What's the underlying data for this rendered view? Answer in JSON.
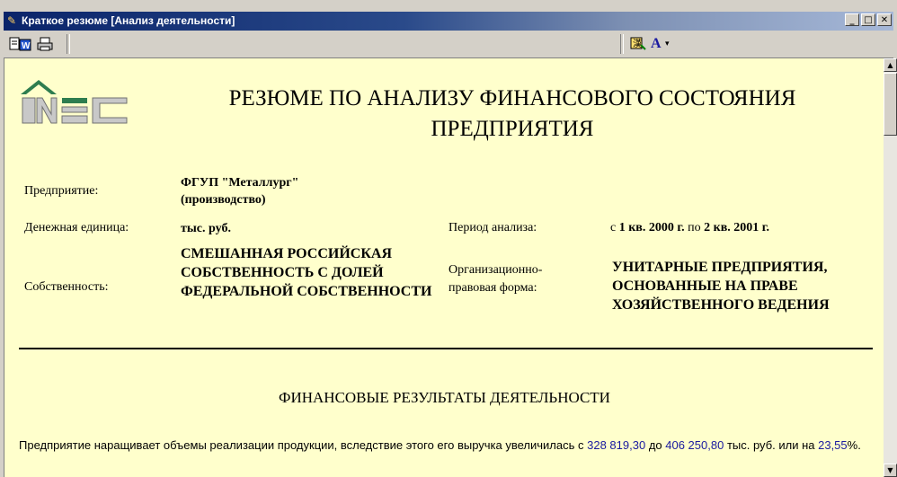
{
  "window": {
    "title": "Краткое резюме [Анализ деятельности]",
    "buttons": {
      "minimize": "_",
      "maximize": "□",
      "close": "✕"
    }
  },
  "toolbar": {
    "font_button": "A",
    "dropdown_arrow": "▾"
  },
  "report": {
    "logo_text": "INEC",
    "title": "РЕЗЮМЕ ПО АНАЛИЗУ ФИНАНСОВОГО СОСТОЯНИЯ ПРЕДПРИЯТИЯ",
    "enterprise_label": "Предприятие:",
    "enterprise_value": "ФГУП \"Металлург\" (производство)",
    "currency_label": "Денежная единица:",
    "currency_value": "тыс. руб.",
    "period_label": "Период анализа:",
    "period_prefix": "с",
    "period_from": "1 кв. 2000 г.",
    "period_mid": "по",
    "period_to": "2 кв. 2001 г.",
    "ownership_label": "Собственность:",
    "ownership_value": "СМЕШАННАЯ РОССИЙСКАЯ СОБСТВЕННОСТЬ С ДОЛЕЙ ФЕДЕРАЛЬНОЙ СОБСТВЕННОСТИ",
    "legal_form_label": "Организационно-правовая форма:",
    "legal_form_value": "УНИТАРНЫЕ ПРЕДПРИЯТИЯ, ОСНОВАННЫЕ НА ПРАВЕ ХОЗЯЙСТВЕННОГО ВЕДЕНИЯ",
    "section_title": "ФИНАНСОВЫЕ РЕЗУЛЬТАТЫ ДЕЯТЕЛЬНОСТИ",
    "para_text_1": "Предприятие наращивает объемы реализации продукции, вследствие этого его выручка увеличилась с ",
    "para_num_1": "328 819,30",
    "para_text_2": " до ",
    "para_num_2": "406 250,80",
    "para_text_3": " тыс. руб. или на ",
    "para_num_3": "23,55",
    "para_text_4": "%."
  },
  "scrollbar": {
    "up": "▲",
    "down": "▼"
  },
  "colors": {
    "content_bg": "#ffffcc",
    "title_bar": "#0a246a",
    "link_numbers": "#1a1aa0",
    "logo_green": "#2e7d4f"
  }
}
